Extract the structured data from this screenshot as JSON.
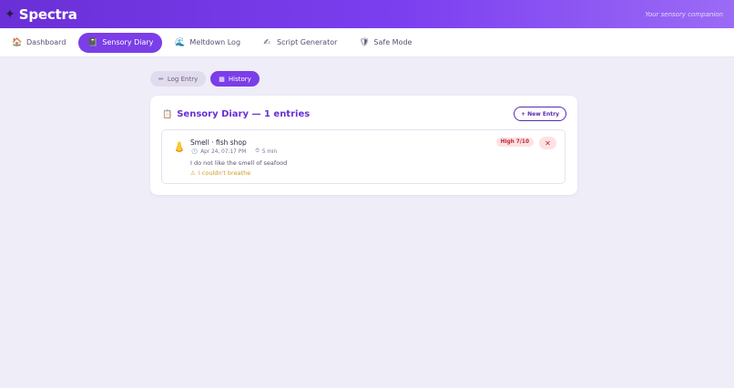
{
  "header": {
    "logo_icon": "✦",
    "app_name": "Spectra",
    "tagline": "Your sensory companion"
  },
  "nav": {
    "items": [
      {
        "label": "Dashboard",
        "icon": "🏠",
        "icon_name": "house-icon",
        "active": false
      },
      {
        "label": "Sensory Diary",
        "icon": "📓",
        "icon_name": "notebook-icon",
        "active": true
      },
      {
        "label": "Meltdown Log",
        "icon": "🌊",
        "icon_name": "wave-icon",
        "active": false
      },
      {
        "label": "Script Generator",
        "icon": "✍",
        "icon_name": "writing-hand-icon",
        "active": false
      },
      {
        "label": "Safe Mode",
        "icon": "🛡",
        "icon_name": "shield-icon",
        "active": false
      }
    ]
  },
  "tabs": {
    "log_entry": {
      "label": "Log Entry",
      "icon": "✏",
      "active": false
    },
    "history": {
      "label": "History",
      "icon": "▦",
      "active": true
    }
  },
  "diary": {
    "icon": "📋",
    "title": "Sensory Diary — 1 entries",
    "new_entry_label": "+ New Entry",
    "entries": [
      {
        "icon": "👃",
        "title": "Smell · fish shop",
        "clock_icon": "🕐",
        "date": "Apr 24, 07:17 PM",
        "timer_icon": "⏱",
        "duration": "5 min",
        "note": "I do not like the smell of seafood",
        "warning_icon": "⚠",
        "warning": "I couldn't breathe",
        "severity": "High 7/10",
        "delete_label": "✕"
      }
    ]
  },
  "colors": {
    "accent": "#7b3ee8",
    "header_start": "#6a2fd6",
    "header_end": "#9b6bf5",
    "danger": "#c0283a",
    "warning": "#d49a1e",
    "background": "#efedf8"
  }
}
